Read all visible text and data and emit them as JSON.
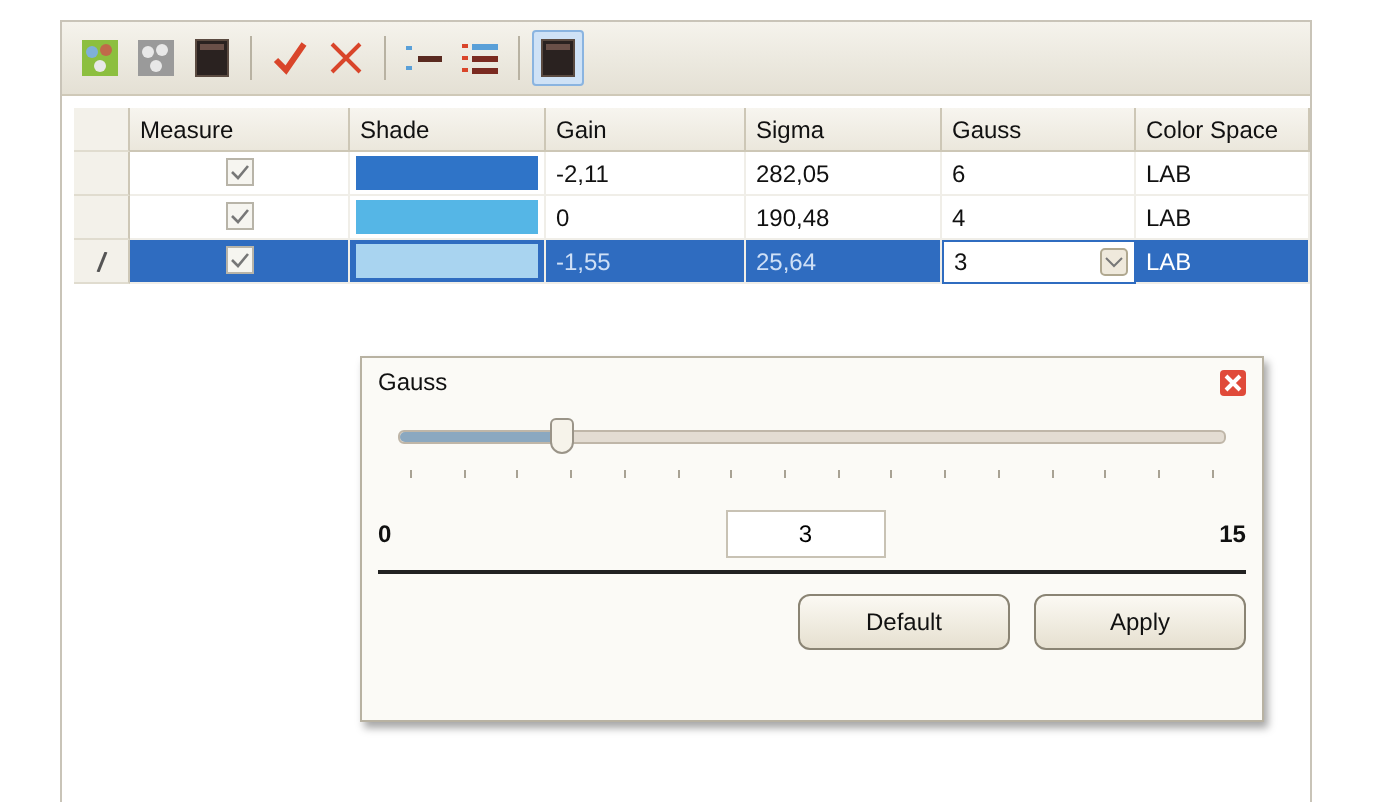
{
  "toolbar": {
    "buttons": [
      {
        "kind": "dots-green",
        "selected": false
      },
      {
        "kind": "dots-grey",
        "selected": false
      },
      {
        "kind": "dark-panel",
        "selected": false
      },
      {
        "kind": "check",
        "selected": false
      },
      {
        "kind": "cross",
        "selected": false
      },
      {
        "kind": "lines-few",
        "selected": false
      },
      {
        "kind": "lines-many",
        "selected": false
      },
      {
        "kind": "dark-panel",
        "selected": true
      }
    ]
  },
  "table": {
    "columns": [
      "Measure",
      "Shade",
      "Gain",
      "Sigma",
      "Gauss",
      "Color Space"
    ],
    "rows": [
      {
        "selected": false,
        "editing": false,
        "measure": true,
        "color": "#2f74c8",
        "gain": "-2,11",
        "sigma": "282,05",
        "gauss": "6",
        "color_space": "LAB"
      },
      {
        "selected": false,
        "editing": false,
        "measure": true,
        "color": "#55b6e6",
        "gain": "0",
        "sigma": "190,48",
        "gauss": "4",
        "color_space": "LAB"
      },
      {
        "selected": true,
        "editing": true,
        "measure": true,
        "color": "#a9d4f0",
        "gain": "-1,55",
        "sigma": "25,64",
        "gauss": "3",
        "color_space": "LAB"
      }
    ]
  },
  "popup": {
    "title": "Gauss",
    "level": 0.2,
    "min": "0",
    "max": "15",
    "value": "3",
    "buttons": [
      "Default",
      "Apply"
    ]
  }
}
